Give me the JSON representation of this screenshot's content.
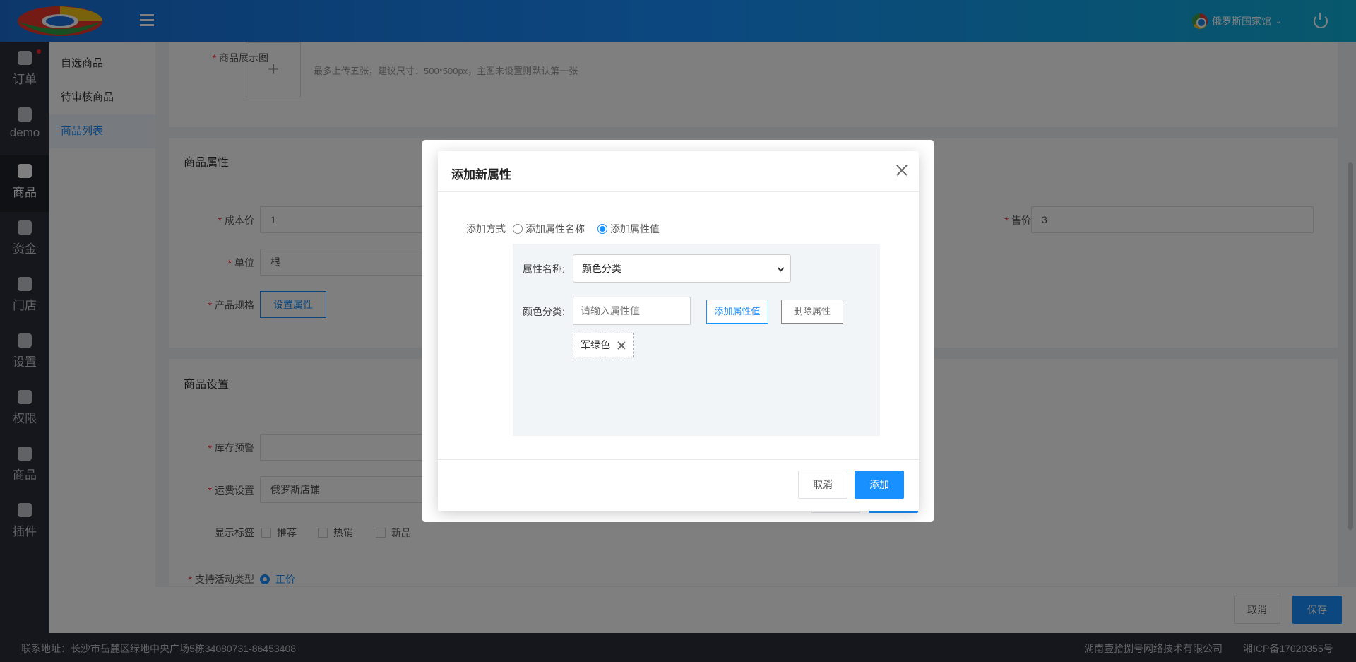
{
  "colors": {
    "topbar": "#1890ff",
    "rail": "#2b2f38",
    "primary": "#1890ff",
    "required": "#f5222d"
  },
  "header": {
    "store_name": "俄罗斯国家馆"
  },
  "rail": {
    "items": [
      {
        "label": "订单",
        "icon": "order-icon"
      },
      {
        "label": "demo",
        "icon": "pie-chart-icon"
      },
      {
        "label": "商品",
        "icon": "shopping-bag-icon"
      },
      {
        "label": "资金",
        "icon": "wallet-icon"
      },
      {
        "label": "门店",
        "icon": "store-icon"
      },
      {
        "label": "设置",
        "icon": "puzzle-icon"
      },
      {
        "label": "权限",
        "icon": "shield-icon"
      },
      {
        "label": "商品",
        "icon": "pie-chart-icon"
      },
      {
        "label": "插件",
        "icon": "puzzle-icon"
      }
    ]
  },
  "submenu": {
    "items": [
      "自选商品",
      "待审核商品",
      "商品列表"
    ]
  },
  "form": {
    "image_label": "商品展示图",
    "image_hint": "最多上传五张，建议尺寸：500*500px，主图未设置则默认第一张",
    "attr_section": "商品属性",
    "cost_label": "成本价",
    "cost_value": "1",
    "sale_label": "售价",
    "sale_value": "3",
    "unit_label": "单位",
    "unit_value": "根",
    "spec_label": "产品规格",
    "spec_button": "设置属性",
    "settings_section": "商品设置",
    "stock_label": "库存预警",
    "freight_label": "运费设置",
    "freight_value": "俄罗斯店铺",
    "tags_label": "显示标签",
    "tag_options": [
      "推荐",
      "热销",
      "新品"
    ],
    "activity_label": "支持活动类型",
    "activity_value": "正价"
  },
  "bottom": {
    "cancel": "取消",
    "save": "保存"
  },
  "footer": {
    "address": "联系地址：长沙市岳麓区绿地中央广场5栋34080731-86453408",
    "company": "湖南壹拾捌号网络技术有限公司",
    "icp": "湘ICP备17020355号"
  },
  "dialog": {
    "title": "添加新属性",
    "mode_label": "添加方式",
    "mode_options": [
      "添加属性名称",
      "添加属性值"
    ],
    "mode_selected": "添加属性值",
    "attr_name_label": "属性名称:",
    "attr_name_value": "颜色分类",
    "value_label": "颜色分类:",
    "value_placeholder": "请输入属性值",
    "add_value_button": "添加属性值",
    "delete_attr_button": "删除属性",
    "tags": [
      "军绿色"
    ],
    "cancel_button": "取消",
    "add_button": "添加"
  }
}
